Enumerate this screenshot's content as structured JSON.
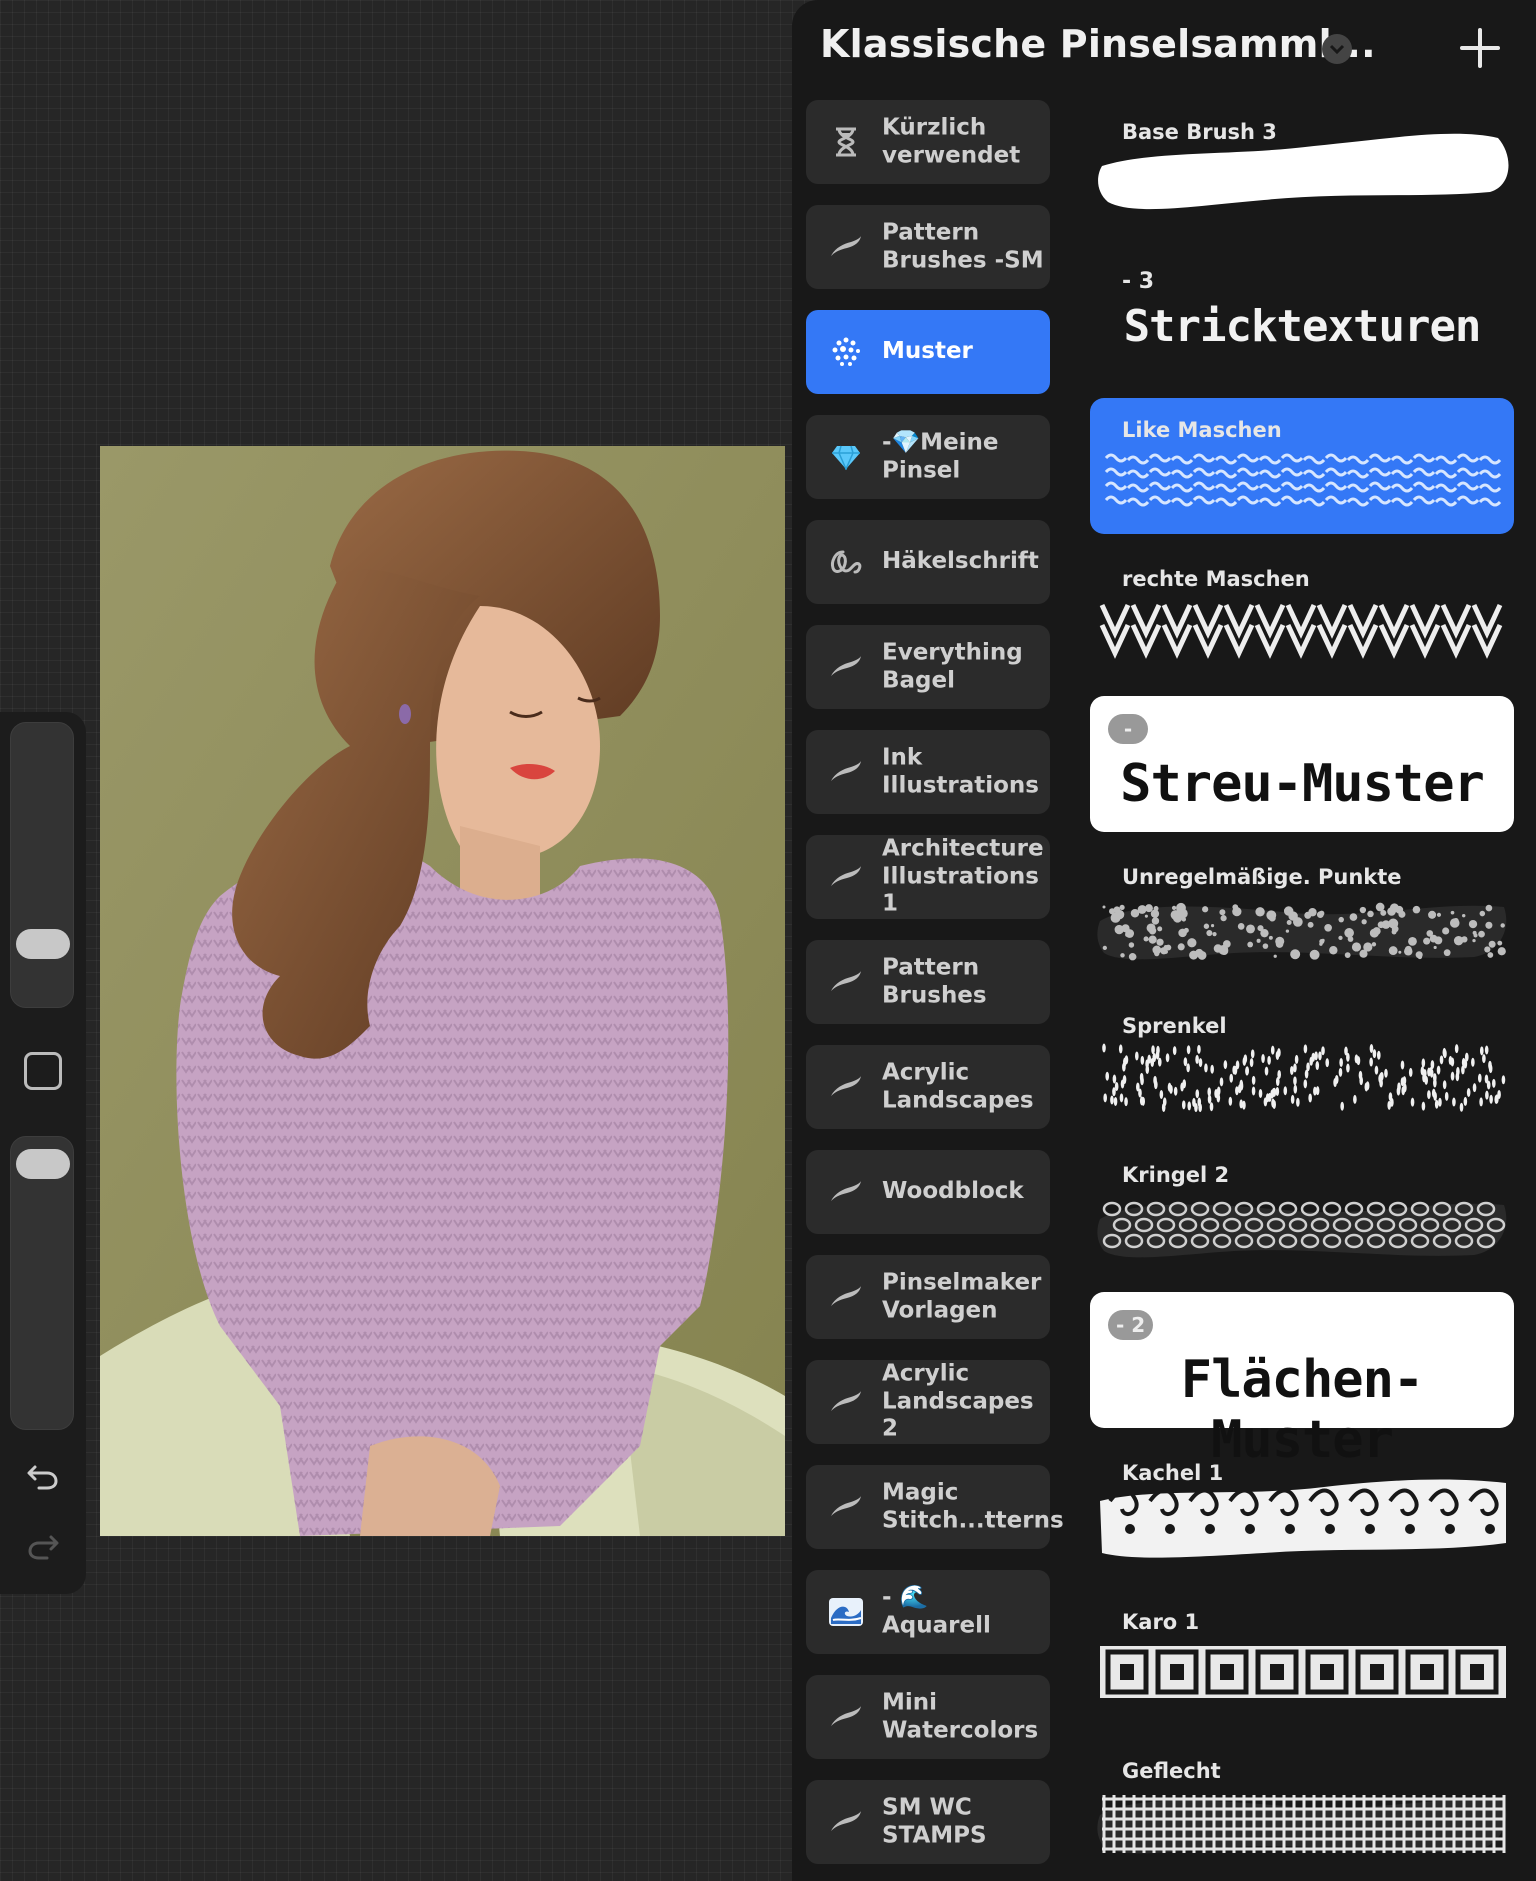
{
  "panel": {
    "title": "Klassische Pinselsamml...",
    "add_label": "+"
  },
  "brush_sets": [
    {
      "label": "Kürzlich\nverwendet",
      "icon": "hourglass-icon",
      "active": false
    },
    {
      "label": "Pattern\nBrushes -SM",
      "icon": "brush-stroke-icon",
      "active": false
    },
    {
      "label": "Muster",
      "icon": "dots-icon",
      "active": true
    },
    {
      "label": "-💎Meine\nPinsel",
      "icon": "diamond-icon",
      "active": false
    },
    {
      "label": "Häkelschrift",
      "icon": "script-icon",
      "active": false
    },
    {
      "label": "Everything\nBagel",
      "icon": "brush-stroke-icon",
      "active": false
    },
    {
      "label": "Ink\nIllustrations",
      "icon": "brush-stroke-icon",
      "active": false
    },
    {
      "label": "Architecture\nIllustrations 1",
      "icon": "brush-stroke-icon",
      "active": false
    },
    {
      "label": "Pattern\nBrushes",
      "icon": "brush-stroke-icon",
      "active": false
    },
    {
      "label": "Acrylic\nLandscapes",
      "icon": "brush-stroke-icon",
      "active": false
    },
    {
      "label": "Woodblock",
      "icon": "brush-stroke-icon",
      "active": false
    },
    {
      "label": "Pinselmaker\nVorlagen",
      "icon": "brush-stroke-icon",
      "active": false
    },
    {
      "label": "Acrylic\nLandscapes 2",
      "icon": "brush-stroke-icon",
      "active": false
    },
    {
      "label": "Magic\nStitch...tterns",
      "icon": "brush-stroke-icon",
      "active": false
    },
    {
      "label": "- 🌊 Aquarell",
      "icon": "wave-icon",
      "active": false
    },
    {
      "label": "Mini\nWatercolors",
      "icon": "brush-stroke-icon",
      "active": false
    },
    {
      "label": "SM WC\nSTAMPS",
      "icon": "brush-stroke-icon",
      "active": false
    }
  ],
  "brushes": [
    {
      "name": "Base Brush 3",
      "kind": "brush",
      "stroke": "solid"
    },
    {
      "name": "Stricktexturen",
      "kind": "section-dark",
      "number": "- 3"
    },
    {
      "name": "Like Maschen",
      "kind": "brush",
      "stroke": "waves",
      "active": true
    },
    {
      "name": "rechte Maschen",
      "kind": "brush",
      "stroke": "chevrons"
    },
    {
      "name": "Streu-Muster",
      "kind": "section-card",
      "number": "-"
    },
    {
      "name": "Unregelmäßige. Punkte",
      "kind": "brush",
      "stroke": "dots"
    },
    {
      "name": "Sprenkel",
      "kind": "brush",
      "stroke": "speckles"
    },
    {
      "name": "Kringel 2",
      "kind": "brush",
      "stroke": "rings"
    },
    {
      "name": "Flächen-Muster",
      "kind": "section-card",
      "number": "- 2"
    },
    {
      "name": "Kachel 1",
      "kind": "brush",
      "stroke": "tiles"
    },
    {
      "name": "Karo 1",
      "kind": "brush",
      "stroke": "squares"
    },
    {
      "name": "Geflecht",
      "kind": "brush",
      "stroke": "weave"
    }
  ],
  "colors": {
    "accent": "#3478f6",
    "panel_bg": "#181818",
    "set_bg": "#2b2b2b",
    "canvas_bg": "#8f8d5d",
    "sweater": "#c6a3c3",
    "hair": "#7a4a2e",
    "skin": "#e6b99a",
    "pants": "#d9dcb8"
  }
}
